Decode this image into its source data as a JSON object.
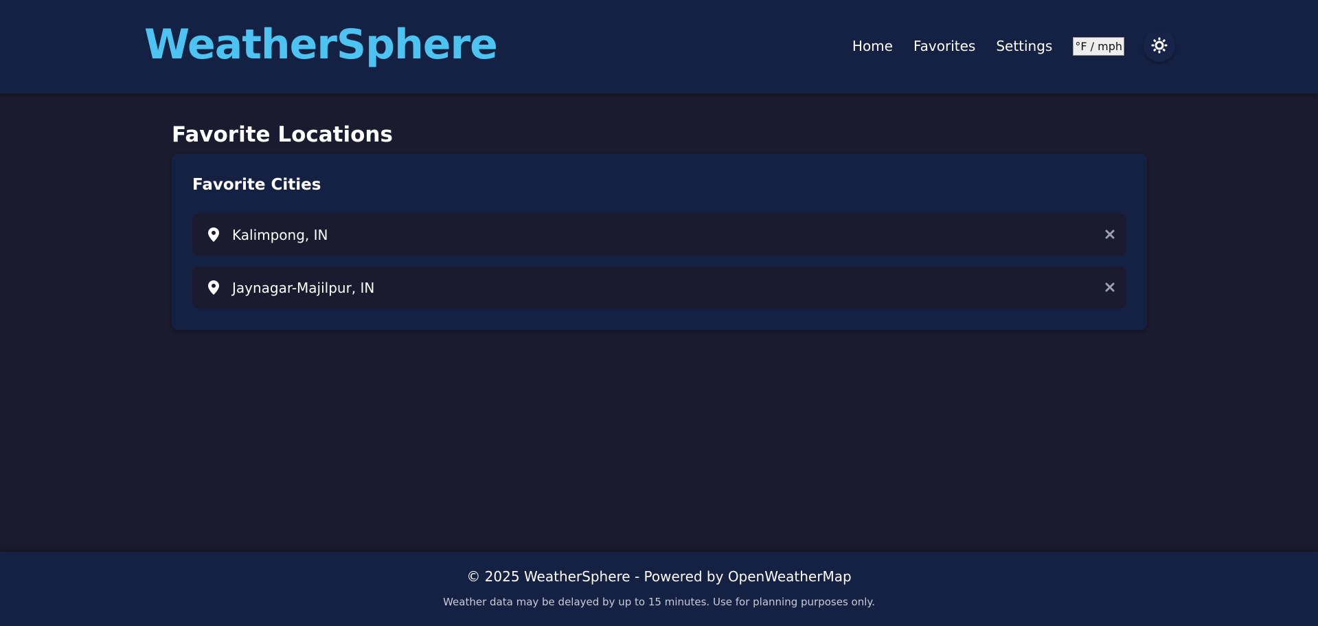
{
  "header": {
    "logo": "WeatherSphere",
    "nav": [
      {
        "label": "Home"
      },
      {
        "label": "Favorites"
      },
      {
        "label": "Settings"
      }
    ],
    "units_toggle": "°F / mph",
    "theme_icon": "sun-icon"
  },
  "main": {
    "page_title": "Favorite Locations",
    "card_title": "Favorite Cities",
    "favorites": [
      {
        "name": "Kalimpong, IN",
        "icon": "map-pin-icon",
        "remove_icon": "close-icon"
      },
      {
        "name": "Jaynagar-Majilpur, IN",
        "icon": "map-pin-icon",
        "remove_icon": "close-icon"
      }
    ]
  },
  "footer": {
    "main": "© 2025 WeatherSphere - Powered by OpenWeatherMap",
    "note": "Weather data may be delayed by up to 15 minutes. Use for planning purposes only."
  },
  "colors": {
    "accent": "#4cc3f1",
    "header_bg": "#152142",
    "page_bg": "#1a1b2e"
  }
}
